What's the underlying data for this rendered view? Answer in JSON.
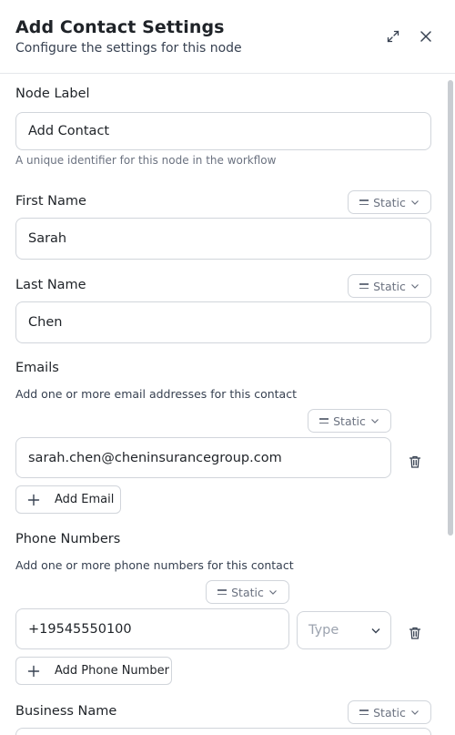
{
  "header": {
    "title": "Add Contact Settings",
    "subtitle": "Configure the settings for this node"
  },
  "node_label": {
    "label": "Node Label",
    "value": "Add Contact",
    "hint": "A unique identifier for this node in the workflow"
  },
  "first_name": {
    "label": "First Name",
    "mode": "Static",
    "value": "Sarah"
  },
  "last_name": {
    "label": "Last Name",
    "mode": "Static",
    "value": "Chen"
  },
  "emails": {
    "label": "Emails",
    "help": "Add one or more email addresses for this contact",
    "mode": "Static",
    "items": [
      "sarah.chen@cheninsurancegroup.com"
    ],
    "add_label": "Add Email"
  },
  "phones": {
    "label": "Phone Numbers",
    "help": "Add one or more phone numbers for this contact",
    "mode": "Static",
    "items": [
      {
        "number": "+19545550100",
        "type_placeholder": "Type"
      }
    ],
    "add_label": "Add Phone Number"
  },
  "business_name": {
    "label": "Business Name",
    "mode": "Static"
  },
  "icons": {
    "expand": "expand-icon",
    "close": "close-icon",
    "trash": "trash-icon",
    "plus": "plus-icon",
    "chevron": "chevron-down-icon",
    "static_mode": "equals-icon"
  }
}
